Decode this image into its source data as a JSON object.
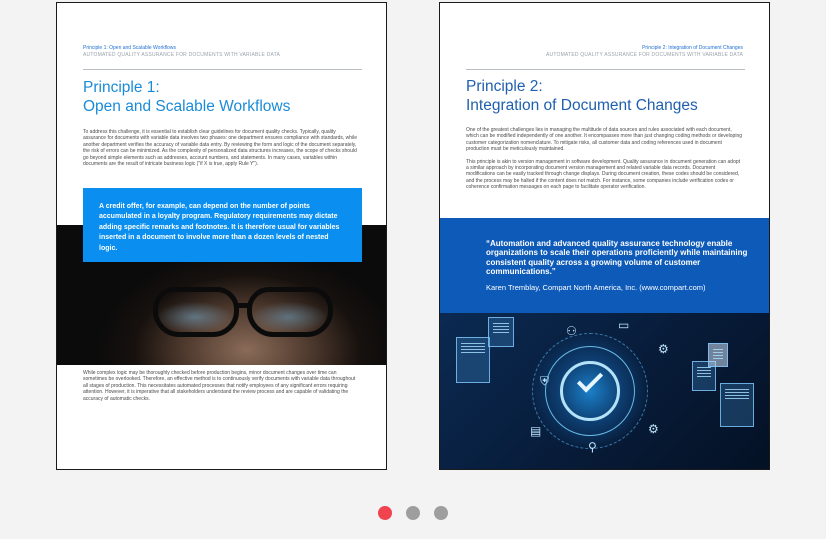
{
  "pages": {
    "left": {
      "header_line1": "Principle 1: Open and Scalable Workflows",
      "header_line2": "AUTOMATED QUALITY ASSURANCE FOR DOCUMENTS WITH VARIABLE DATA",
      "title_line1": "Principle 1:",
      "title_line2": "Open and Scalable Workflows",
      "body_top": "To address this challenge, it is essential to establish clear guidelines for document quality checks. Typically, quality assurance for documents with variable data involves two phases: one department ensures compliance with standards, while another department verifies the accuracy of variable data entry. By reviewing the form and logic of the document separately, the risk of errors can be minimized. As the complexity of personalized data structures increases, the scope of checks should go beyond simple elements such as addresses, account numbers, and statements. In many cases, variables within documents are the result of intricate business logic (\"if X is true, apply Rule Y\").",
      "callout": "A credit offer, for example, can depend on the number of points accumulated in a loyalty program. Regulatory requirements may dictate adding specific remarks and footnotes. It is therefore usual for variables inserted in a document to involve more than a dozen levels of nested logic.",
      "body_bottom": "While complex logic may be thoroughly checked before production begins, minor document changes over time can sometimes be overlooked. Therefore, an effective method is to continuously verify documents with variable data throughout all stages of production. This necessitates automated processes that notify employees of any significant errors requiring attention. However, it is imperative that all stakeholders understand the review process and are capable of validating the accuracy of automatic checks."
    },
    "right": {
      "header_line1": "Principle 2: Integration of Document Changes",
      "header_line2": "AUTOMATED QUALITY ASSURANCE FOR DOCUMENTS WITH VARIABLE DATA",
      "title_line1": "Principle 2:",
      "title_line2": "Integration of Document Changes",
      "body_p1": "One of the greatest challenges lies in managing the multitude of data sources and rules associated with each document, which can be modified independently of one another. It encompasses more than just changing coding methods or developing customer categorization nomenclature. To mitigate risks, all customer data and coding references used in document production must be meticulously maintained.",
      "body_p2": "This principle is akin to version management in software development. Quality assurance in document generation can adopt a similar approach by incorporating document version management and related variable data records. Document modifications can be easily tracked through change displays. During document creation, these codes should be considered, and the process may be halted if the content does not match. For instance, some companies include verification codes or coherence confirmation messages on each page to facilitate operator verification.",
      "quote": "“Automation and advanced quality assurance technology enable organizations to scale their operations proficiently while maintaining consistent quality across a growing volume of customer communications.”",
      "quote_author": "Karen Tremblay, Compart North America, Inc. (www.compart.com)"
    }
  },
  "carousel": {
    "count": 3,
    "active_index": 0,
    "active_color": "#f0434f",
    "inactive_color": "#9e9e9e"
  },
  "colors": {
    "callout_blue": "#0a8ff0",
    "quote_band_blue": "#0d5ab8",
    "title_blue_left": "#1a8bd8",
    "title_blue_right": "#1f5fae"
  }
}
